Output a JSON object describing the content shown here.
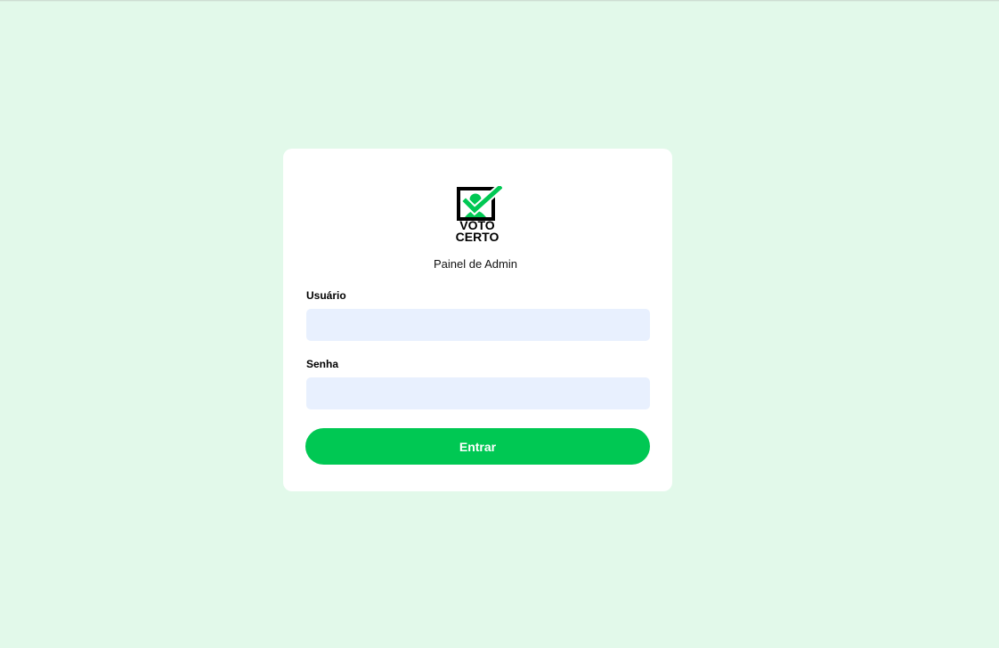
{
  "brand": {
    "logo_line1": "VOTO",
    "logo_line2": "CERTO",
    "accent_color": "#00c853",
    "icon": "ballot-check-icon"
  },
  "login": {
    "subtitle": "Painel de Admin",
    "username_label": "Usuário",
    "username_value": "",
    "password_label": "Senha",
    "password_value": "",
    "submit_label": "Entrar"
  },
  "colors": {
    "background": "#e2f9ea",
    "card": "#ffffff",
    "input_bg": "#e8f0fe"
  }
}
